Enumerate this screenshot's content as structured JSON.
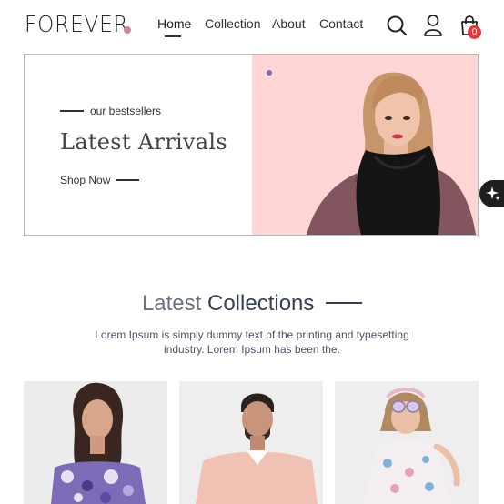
{
  "brand": {
    "name": "FOREVER",
    "dot_color": "#c586a5"
  },
  "nav": {
    "items": [
      {
        "label": "Home",
        "active": true
      },
      {
        "label": "Collection",
        "active": false
      },
      {
        "label": "About",
        "active": false
      },
      {
        "label": "Contact",
        "active": false
      }
    ],
    "icons": [
      "search-icon",
      "profile-icon",
      "cart-icon"
    ],
    "cart_count": "0"
  },
  "hero": {
    "eyebrow": "our bestsellers",
    "title": "Latest Arrivals",
    "cta": "Shop Now",
    "bg_color": "#ffd6d6"
  },
  "collections": {
    "title_part1": "Latest",
    "title_part2": "Collections",
    "description": "Lorem Ipsum is simply dummy text of the printing and typesetting industry. Lorem Ipsum has been the.",
    "products": [
      {
        "image": "woman-floral-top"
      },
      {
        "image": "man-pink-sweater"
      },
      {
        "image": "girl-floral-dress"
      }
    ]
  },
  "colors": {
    "accent": "#c586a5",
    "badge": "#e03c3c",
    "text": "#374151"
  }
}
